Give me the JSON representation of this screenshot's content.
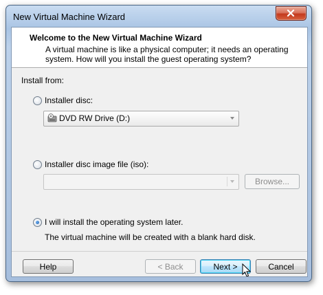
{
  "window": {
    "title": "New Virtual Machine Wizard"
  },
  "header": {
    "title": "Welcome to the New Virtual Machine Wizard",
    "description": "A virtual machine is like a physical computer; it needs an operating system. How will you install the guest operating system?"
  },
  "install": {
    "label": "Install from:",
    "option_disc": {
      "label": "Installer disc:",
      "checked": false
    },
    "disc_drive": {
      "value": "DVD RW Drive (D:)",
      "icon": "dvd-drive-icon"
    },
    "option_iso": {
      "label": "Installer disc image file (iso):",
      "checked": false
    },
    "iso_path": {
      "value": ""
    },
    "browse_label": "Browse...",
    "option_later": {
      "label": "I will install the operating system later.",
      "checked": true
    },
    "later_note": "The virtual machine will be created with a blank hard disk."
  },
  "footer": {
    "help": "Help",
    "back": "< Back",
    "next": "Next >",
    "cancel": "Cancel"
  },
  "colors": {
    "accent": "#3c7fb1",
    "close": "#c3391d"
  }
}
